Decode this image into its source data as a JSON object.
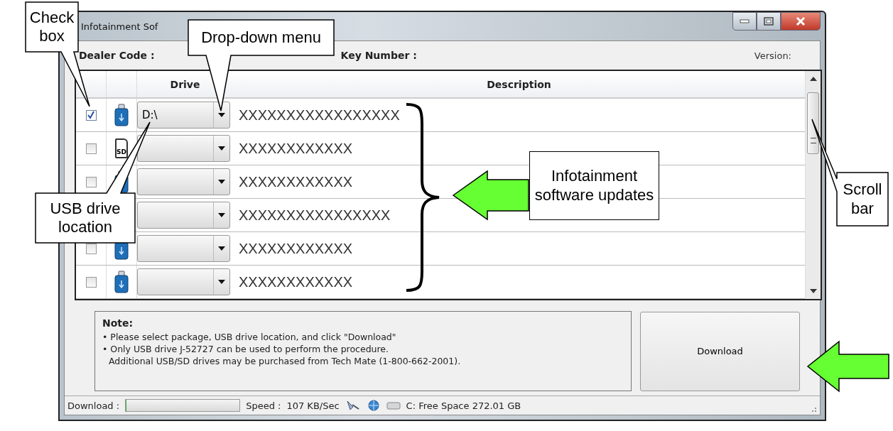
{
  "window": {
    "title": "Infotainment Sof"
  },
  "info": {
    "dealer_code_label": "Dealer Code :",
    "key_number_label": "Key Number :",
    "version_label": "Version:"
  },
  "table": {
    "columns": [
      "Drive",
      "Description"
    ],
    "rows": [
      {
        "checked": true,
        "kind": "usb",
        "drive": "D:\\",
        "description": "XXXXXXXXXXXXXXXXX"
      },
      {
        "checked": false,
        "kind": "sd",
        "icon_text": "SD",
        "description": "XXXXXXXXXXXX"
      },
      {
        "checked": false,
        "kind": "usb",
        "description": "XXXXXXXXXXXX"
      },
      {
        "description": "XXXXXXXXXXXXXXXX"
      },
      {
        "checked": false,
        "kind": "usb",
        "description": "XXXXXXXXXXXX"
      },
      {
        "checked": false,
        "kind": "usb",
        "description": "XXXXXXXXXXXX"
      }
    ]
  },
  "note": {
    "title": "Note:",
    "lines": [
      "• Please select package, USB drive location, and click \"Download\"",
      "• Only USB drive J-52727 can be used to perform the procedure.",
      "Additional USB/SD drives may be purchased from Tech Mate (1-800-662-2001)."
    ]
  },
  "download_button": "Download",
  "status_bar": {
    "download_label": "Download :",
    "download_progress": {
      "level": 0
    },
    "speed_label": "Speed :",
    "speed": "107 KB/Sec",
    "free_space": "C: Free Space 272.01 GB"
  },
  "callouts": [
    {
      "text": "Check box"
    },
    {
      "text": "Drop-down menu"
    },
    {
      "text": "USB drive location"
    },
    {
      "text": "Infotainment software updates"
    },
    {
      "text": "Scroll bar"
    }
  ]
}
